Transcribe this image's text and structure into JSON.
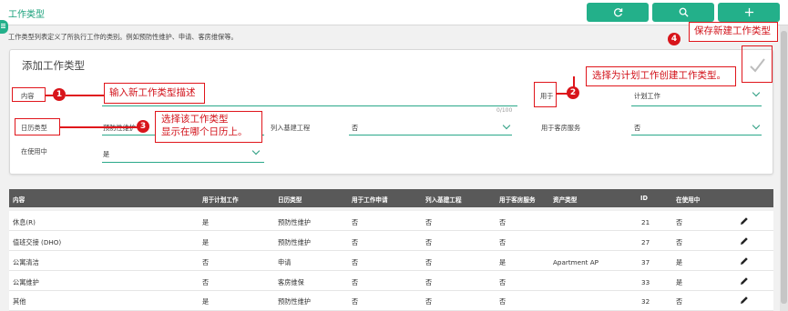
{
  "header": {
    "title": "工作类型",
    "refresh_icon": "refresh-icon",
    "search_icon": "search-icon",
    "add_icon": "plus-icon"
  },
  "description": "工作类型列表定义了所执行工作的类别。例如预防性维护、申请、客房维保等。",
  "form": {
    "title": "添加工作类型",
    "save_icon": "checkmark-icon",
    "content_label": "内容",
    "content_value": "",
    "char_counter": "0/100",
    "used_for_label": "用于",
    "used_for_value": "计划工作",
    "calendar_type_label": "日历类型",
    "calendar_type_value": "预防性维护",
    "capital_project_label": "列入基建工程",
    "capital_project_value": "否",
    "guest_service_label": "用于客房服务",
    "guest_service_value": "否",
    "in_use_label": "在使用中",
    "in_use_value": "是"
  },
  "annotations": {
    "a1_num": "1",
    "a1_text": "输入新工作类型描述",
    "a2_num": "2",
    "a2_text": "选择为计划工作创建工作类型。",
    "a3_num": "3",
    "a3_line1": "选择该工作类型",
    "a3_line2": "显示在哪个日历上。",
    "a4_num": "4",
    "a4_text": "保存新建工作类型"
  },
  "table": {
    "headers": [
      "内容",
      "用于计划工作",
      "日历类型",
      "用于工作申请",
      "列入基建工程",
      "用于客房服务",
      "资产类型",
      "ID",
      "在使用中"
    ],
    "rows": [
      [
        "休息(R)",
        "是",
        "预防性维护",
        "否",
        "否",
        "否",
        "",
        "21",
        "否"
      ],
      [
        "值班交接 (DHO)",
        "是",
        "预防性维护",
        "否",
        "否",
        "否",
        "",
        "27",
        "否"
      ],
      [
        "公寓清洁",
        "否",
        "申请",
        "否",
        "否",
        "是",
        "Apartment AP",
        "37",
        "是"
      ],
      [
        "公寓维护",
        "否",
        "客房维保",
        "否",
        "否",
        "否",
        "",
        "33",
        "是"
      ],
      [
        "其他",
        "是",
        "预防性维护",
        "否",
        "否",
        "否",
        "",
        "32",
        "否"
      ]
    ],
    "edit_icon": "pencil-icon"
  },
  "colors": {
    "accent": "#23b08a",
    "annotation": "#e0151b",
    "table_header": "#595959"
  }
}
